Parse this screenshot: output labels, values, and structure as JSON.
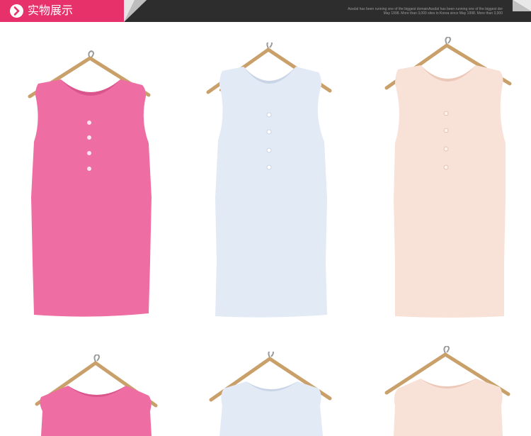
{
  "header": {
    "title": "实物展示",
    "tagline_line1": "Assdal has been running one of the biggest domainAssdal has been running one of the biggest dor",
    "tagline_line2": "May 1998. More than 3,000 sites in Korea since May 1998. More than 3,000"
  },
  "colors": {
    "accent": "#e6316a",
    "header_bg": "#2d2d2d",
    "dress_pink": "#ee6ea3",
    "dress_blue": "#e2eaf6",
    "dress_peach": "#f8e2d8",
    "hanger_wood": "#c9a06a"
  },
  "products": [
    {
      "color": "pink"
    },
    {
      "color": "light-blue"
    },
    {
      "color": "peach"
    },
    {
      "color": "pink"
    },
    {
      "color": "light-blue"
    },
    {
      "color": "peach"
    }
  ],
  "icons": {
    "title": "chevron-right-circle-icon",
    "hanger": "hanger-icon"
  }
}
